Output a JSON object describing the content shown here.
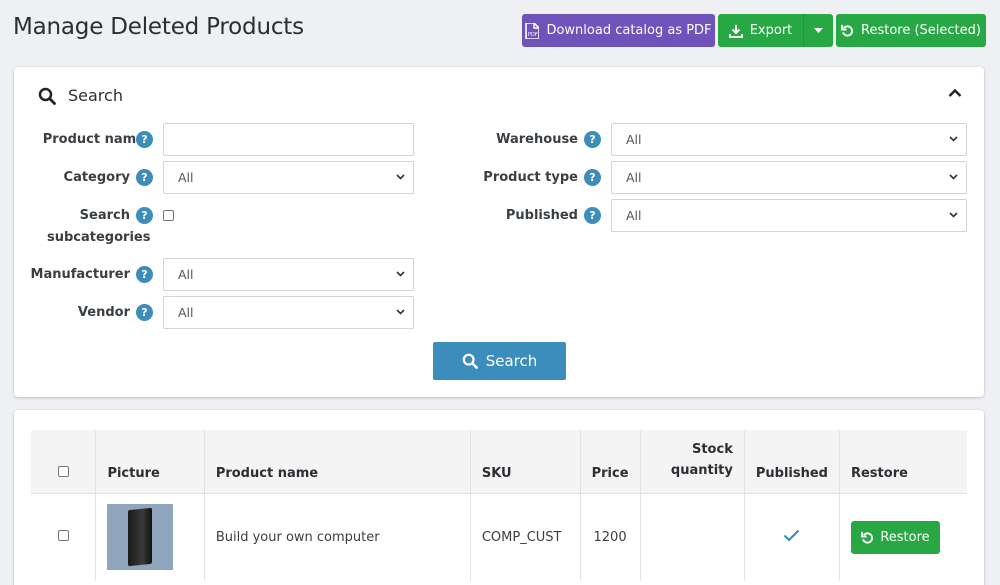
{
  "header": {
    "title": "Manage Deleted Products",
    "download_pdf_label": "Download catalog as PDF",
    "export_label": "Export",
    "restore_selected_label": "Restore (Selected)"
  },
  "search": {
    "title": "Search",
    "product_name_label": "Product name",
    "product_name_value": "",
    "category_label": "Category",
    "category_value": "All",
    "search_sub_label_1": "Search",
    "search_sub_label_2": "subcategories",
    "manufacturer_label": "Manufacturer",
    "manufacturer_value": "All",
    "vendor_label": "Vendor",
    "vendor_value": "All",
    "warehouse_label": "Warehouse",
    "warehouse_value": "All",
    "product_type_label": "Product type",
    "product_type_value": "All",
    "published_label": "Published",
    "published_value": "All",
    "search_button_label": "Search",
    "help_glyph": "?"
  },
  "table": {
    "columns": {
      "picture": "Picture",
      "product_name": "Product name",
      "sku": "SKU",
      "price": "Price",
      "stock_1": "Stock",
      "stock_2": "quantity",
      "published": "Published",
      "restore": "Restore"
    },
    "rows": [
      {
        "product_name": "Build your own computer",
        "sku": "COMP_CUST",
        "price": "1200",
        "stock": "",
        "published": true,
        "restore_label": "Restore"
      }
    ]
  },
  "colors": {
    "pdf_button": "#6f52ba",
    "success": "#28a745",
    "primary": "#3c8dbc"
  }
}
